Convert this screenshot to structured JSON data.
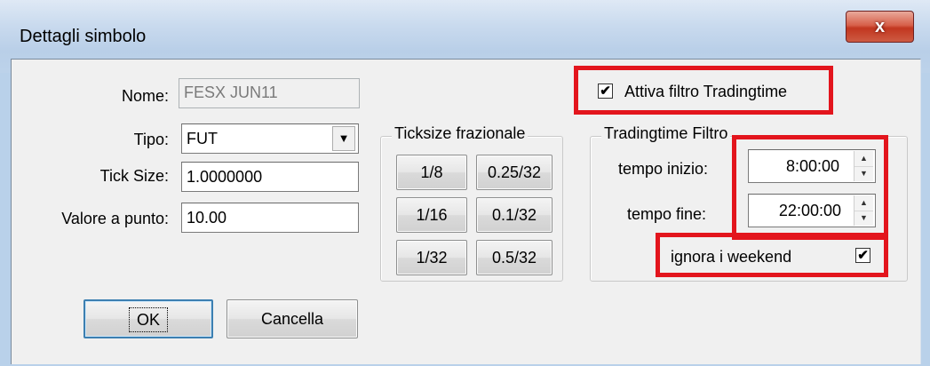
{
  "window": {
    "title": "Dettagli simbolo",
    "close_glyph": "x"
  },
  "form": {
    "nome_label": "Nome:",
    "nome_value": "FESX JUN11",
    "tipo_label": "Tipo:",
    "tipo_value": "FUT",
    "ticksize_label": "Tick Size:",
    "ticksize_value": "1.0000000",
    "valore_label": "Valore a punto:",
    "valore_value": "10.00"
  },
  "ticksize_group": {
    "legend": "Ticksize frazionale",
    "buttons": [
      "1/8",
      "0.25/32",
      "1/16",
      "0.1/32",
      "1/32",
      "0.5/32"
    ]
  },
  "trading": {
    "filter_checkbox_label": "Attiva filtro Tradingtime",
    "filter_checked": true,
    "group_legend": "Tradingtime Filtro",
    "start_label": "tempo inizio:",
    "start_value": "8:00:00",
    "end_label": "tempo fine:",
    "end_value": "22:00:00",
    "weekend_label": "ignora i weekend",
    "weekend_checked": true
  },
  "actions": {
    "ok_label": "OK",
    "cancel_label": "Cancella"
  },
  "colors": {
    "highlight": "#e3151d",
    "client_bg": "#f0f0f0"
  }
}
